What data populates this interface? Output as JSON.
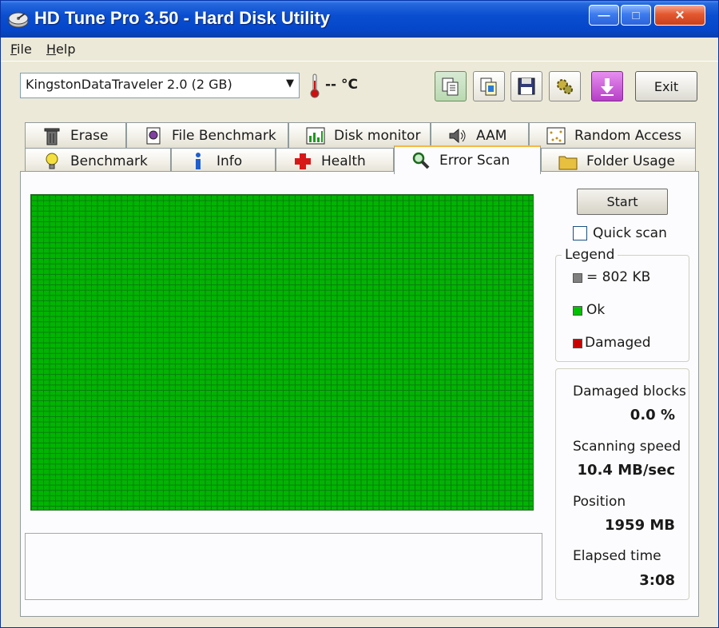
{
  "window": {
    "title": "HD Tune Pro 3.50 - Hard Disk Utility"
  },
  "titlebar_buttons": {
    "minimize": "—",
    "maximize": "□",
    "close": "✕"
  },
  "menu": [
    {
      "label": "File",
      "accel": "F",
      "rest": "ile"
    },
    {
      "label": "Help",
      "accel": "H",
      "rest": "elp"
    }
  ],
  "toolbar": {
    "drive": "KingstonDataTraveler 2.0 (2 GB)",
    "temperature": "-- °C",
    "exit_label": "Exit",
    "icons": [
      "copy-text-icon",
      "copy-screenshot-icon",
      "save-icon",
      "options-icon",
      "download-icon"
    ]
  },
  "tabs": {
    "row_top": [
      "Erase",
      "File Benchmark",
      "Disk monitor",
      "AAM",
      "Random Access"
    ],
    "row_bottom": [
      "Benchmark",
      "Info",
      "Health",
      "Error Scan",
      "Folder Usage"
    ],
    "active": "Error Scan"
  },
  "scan": {
    "start_label": "Start",
    "quick_scan_label": "Quick scan",
    "quick_scan_checked": false,
    "map_status": "ok"
  },
  "legend": {
    "title": "Legend",
    "items": [
      {
        "color": "#808080",
        "label": "= 802 KB"
      },
      {
        "color": "#00c000",
        "label": "Ok"
      },
      {
        "color": "#c80000",
        "label": "Damaged"
      }
    ]
  },
  "stats": {
    "damaged_blocks_label": "Damaged blocks",
    "damaged_blocks_value": "0.0 %",
    "speed_label": "Scanning speed",
    "speed_value": "10.4 MB/sec",
    "position_label": "Position",
    "position_value": "1959 MB",
    "elapsed_label": "Elapsed time",
    "elapsed_value": "3:08"
  },
  "colors": {
    "titlebar": "#0546c9",
    "block_ok": "#00b400",
    "block_grid": "#0c7a14",
    "tab_highlight": "#f5b844"
  }
}
